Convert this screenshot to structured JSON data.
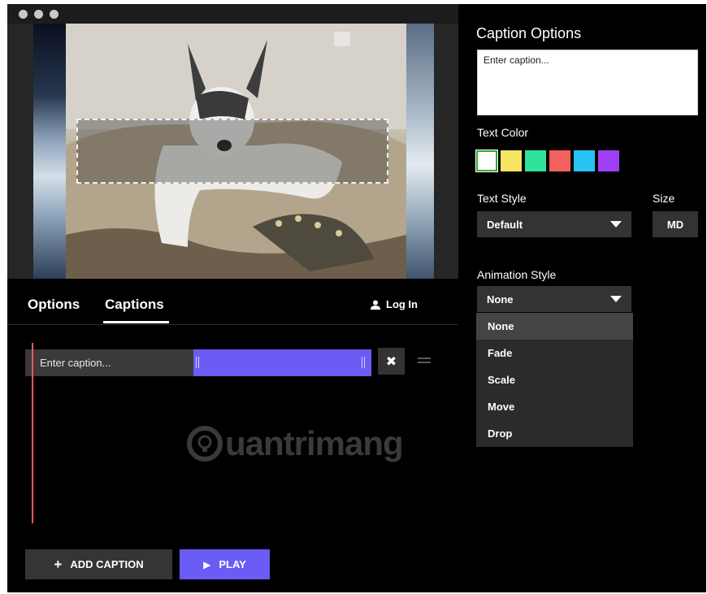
{
  "tabs": {
    "options": "Options",
    "captions": "Captions",
    "login": "Log In"
  },
  "timeline": {
    "caption_text": "Enter caption...",
    "delete_symbol": "✖",
    "add_caption": "ADD CAPTION",
    "play": "PLAY",
    "add_symbol": "+",
    "play_symbol": "▶"
  },
  "watermark": {
    "text": "uantrimang"
  },
  "panel": {
    "title": "Caption Options",
    "caption_placeholder": "Enter caption...",
    "text_color_label": "Text Color",
    "text_style_label": "Text Style",
    "size_label": "Size",
    "text_style_value": "Default",
    "size_value": "MD",
    "animation_label": "Animation Style",
    "animation_value": "None",
    "animation_options": [
      "None",
      "Fade",
      "Scale",
      "Move",
      "Drop"
    ]
  },
  "colors": {
    "swatches": [
      "#ffffff",
      "#f6e562",
      "#2fe39c",
      "#f26060",
      "#27c3f2",
      "#a040f5"
    ],
    "accent": "#6a5cf5",
    "playhead": "#e85959"
  },
  "icons": {
    "login": "user-icon",
    "delete": "close-icon",
    "drag": "drag-handle-icon",
    "add": "plus-icon",
    "play": "play-icon",
    "dropdown": "caret-down-icon"
  }
}
